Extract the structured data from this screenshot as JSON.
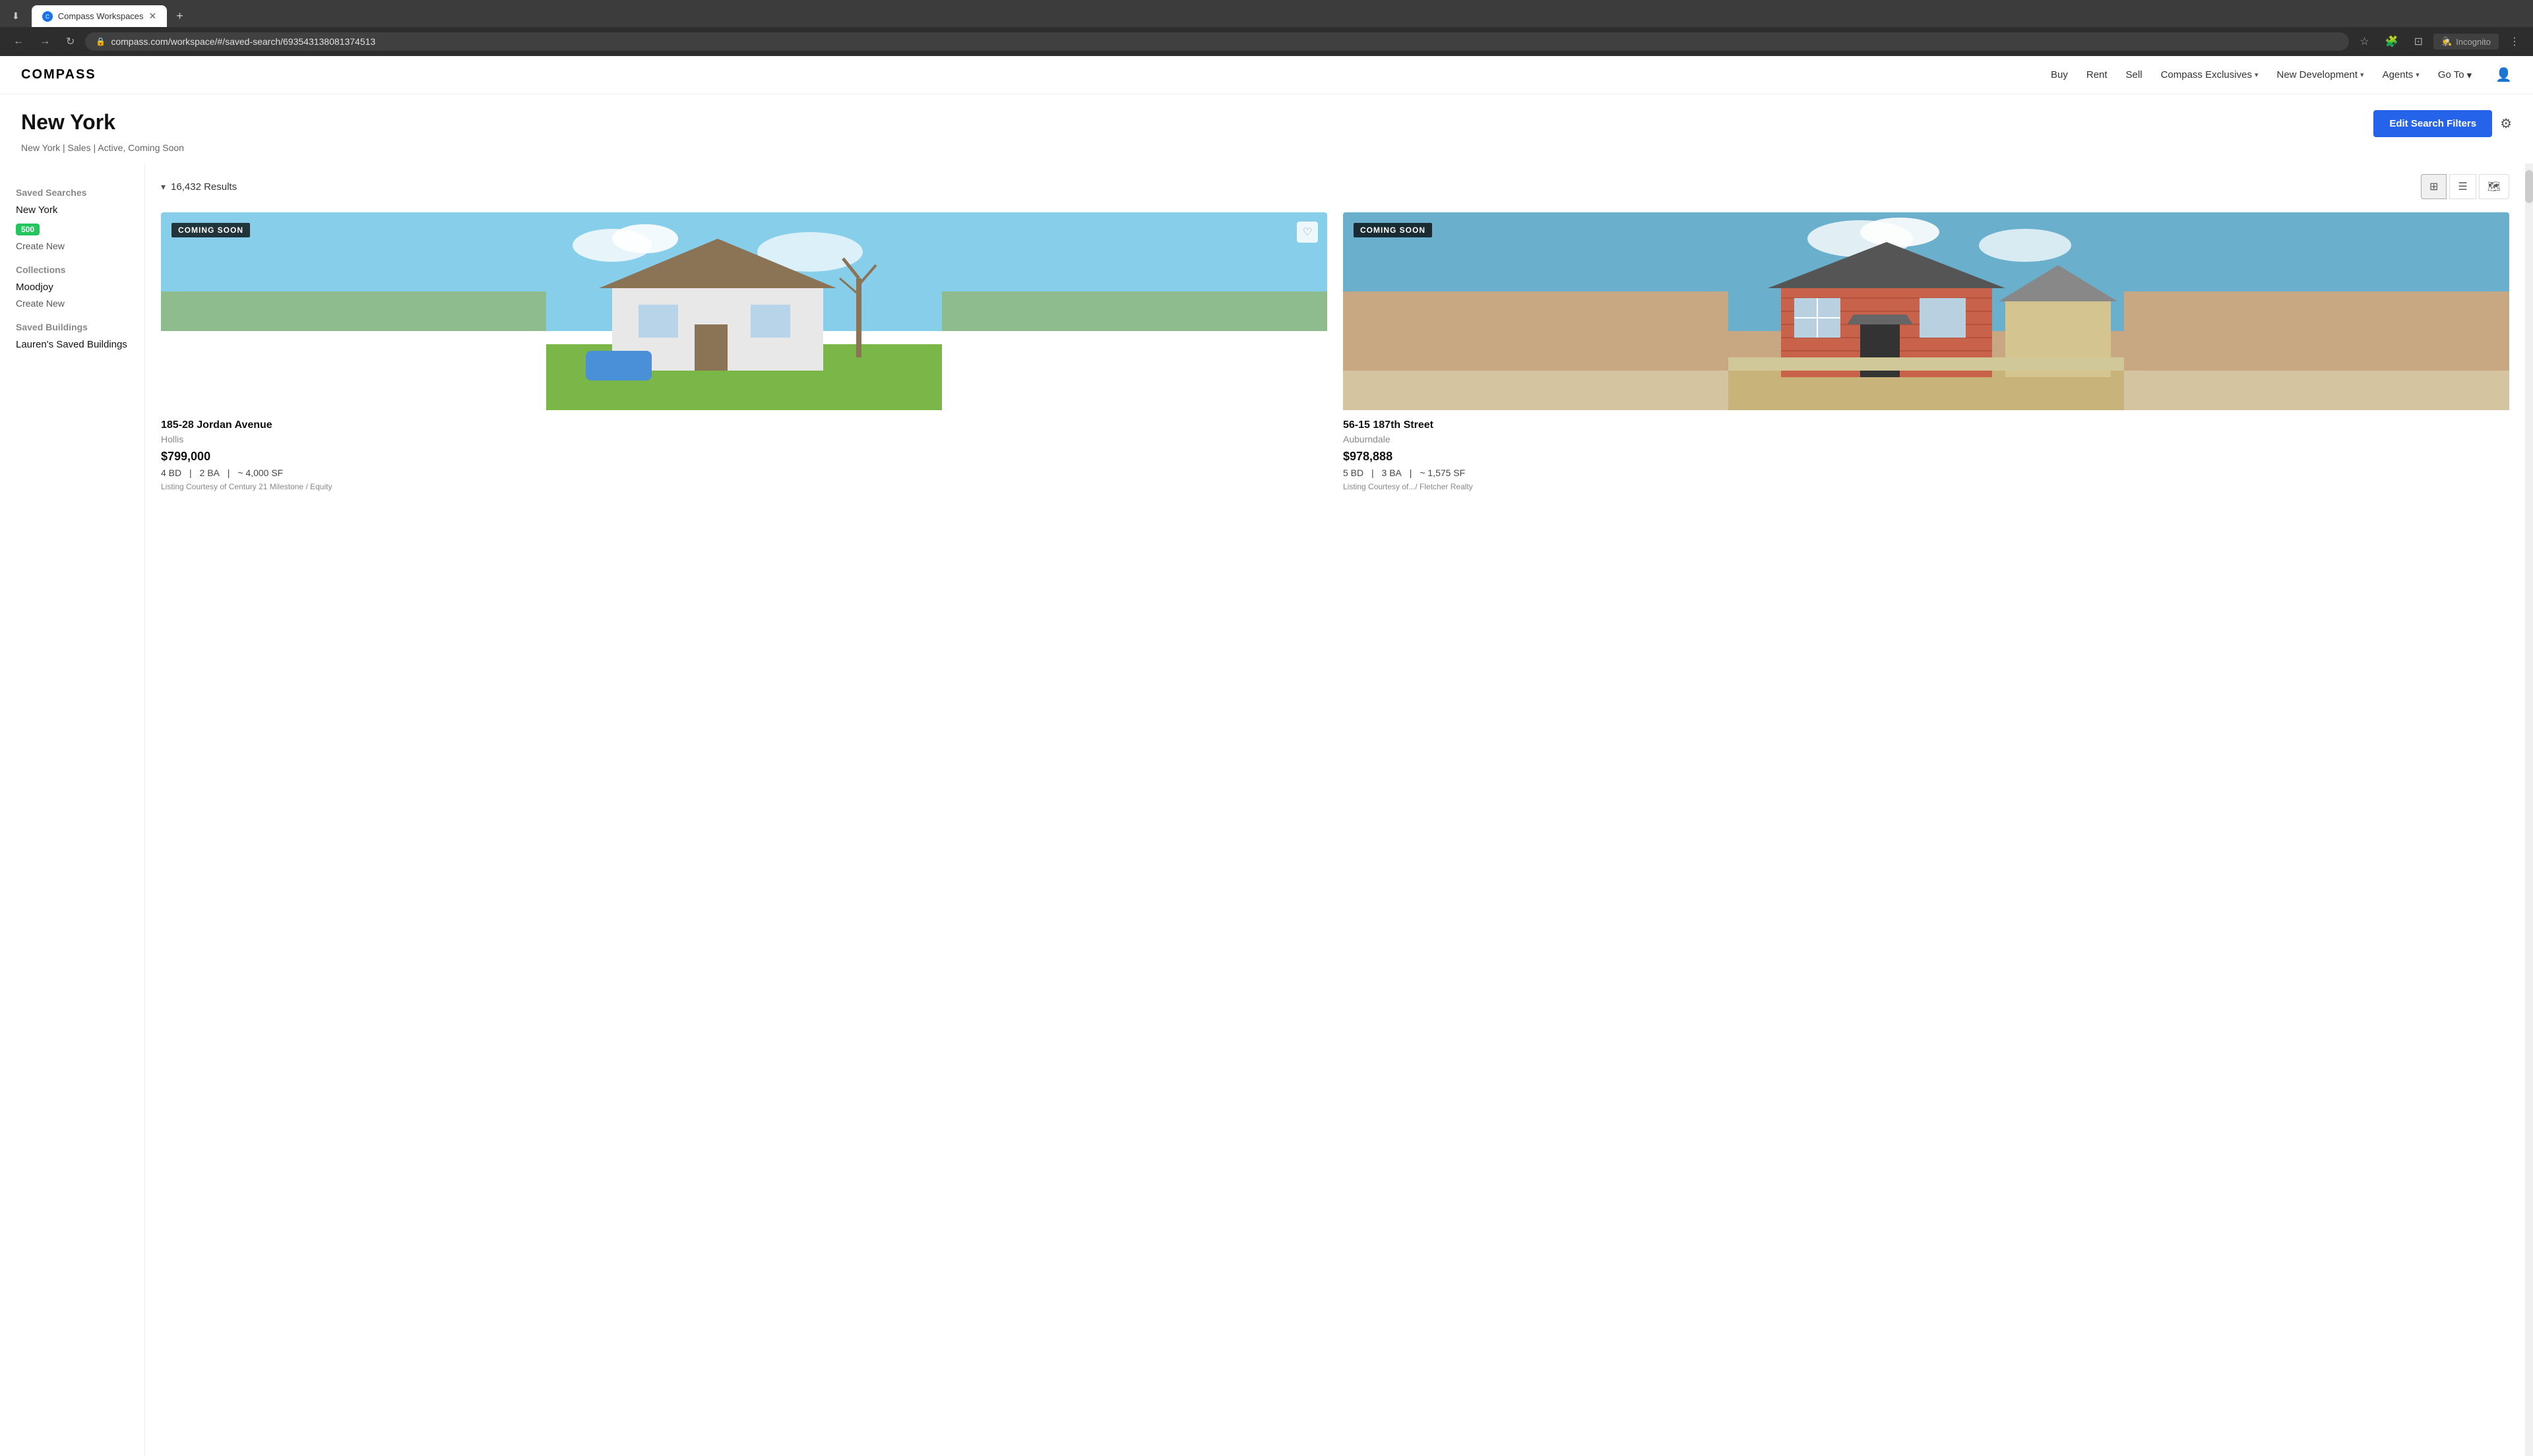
{
  "browser": {
    "tab_title": "Compass Workspaces",
    "tab_favicon": "C",
    "address_bar": "compass.com/workspace/#/saved-search/693543138081374513",
    "incognito_label": "Incognito"
  },
  "nav": {
    "logo": "COMPASS",
    "links": [
      {
        "label": "Buy",
        "dropdown": false
      },
      {
        "label": "Rent",
        "dropdown": false
      },
      {
        "label": "Sell",
        "dropdown": false
      },
      {
        "label": "Compass Exclusives",
        "dropdown": true
      },
      {
        "label": "New Development",
        "dropdown": true
      },
      {
        "label": "Agents",
        "dropdown": true
      }
    ],
    "goto_label": "Go To",
    "goto_chevron": "▾",
    "user_icon": "👤"
  },
  "page_header": {
    "title": "New York",
    "subtitle": "New York | Sales | Active, Coming Soon",
    "edit_filters_btn": "Edit Search Filters"
  },
  "sidebar": {
    "saved_searches_title": "Saved Searches",
    "saved_search_item": "New York",
    "saved_search_badge": "500",
    "create_new_search": "Create New",
    "collections_title": "Collections",
    "collection_item": "Moodjoy",
    "create_new_collection": "Create New",
    "saved_buildings_title": "Saved Buildings",
    "saved_building_item": "Lauren's Saved Buildings"
  },
  "listings": {
    "results_count": "16,432 Results",
    "cards": [
      {
        "status": "COMING SOON",
        "address": "185-28 Jordan Avenue",
        "neighborhood": "Hollis",
        "price": "$799,000",
        "beds": "4 BD",
        "baths": "2 BA",
        "sqft": "~ 4,000 SF",
        "agent": "Listing Courtesy of Century 21 Milestone / Equity",
        "bg": "house1"
      },
      {
        "status": "COMING SOON",
        "address": "56-15 187th Street",
        "neighborhood": "Auburndale",
        "price": "$978,888",
        "beds": "5 BD",
        "baths": "3 BA",
        "sqft": "~ 1,575 SF",
        "agent": "Listing Courtesy of.../ Fletcher Realty",
        "bg": "house2"
      }
    ]
  },
  "icons": {
    "grid_view": "⊞",
    "list_view": "☰",
    "map_view": "🗺",
    "chevron_down": "▾",
    "chevron_right": "›",
    "settings": "⚙",
    "heart": "♡",
    "back": "←",
    "forward": "→",
    "refresh": "↻",
    "star": "☆",
    "extensions": "🧩",
    "profile": "⊡",
    "more": "⋮"
  }
}
